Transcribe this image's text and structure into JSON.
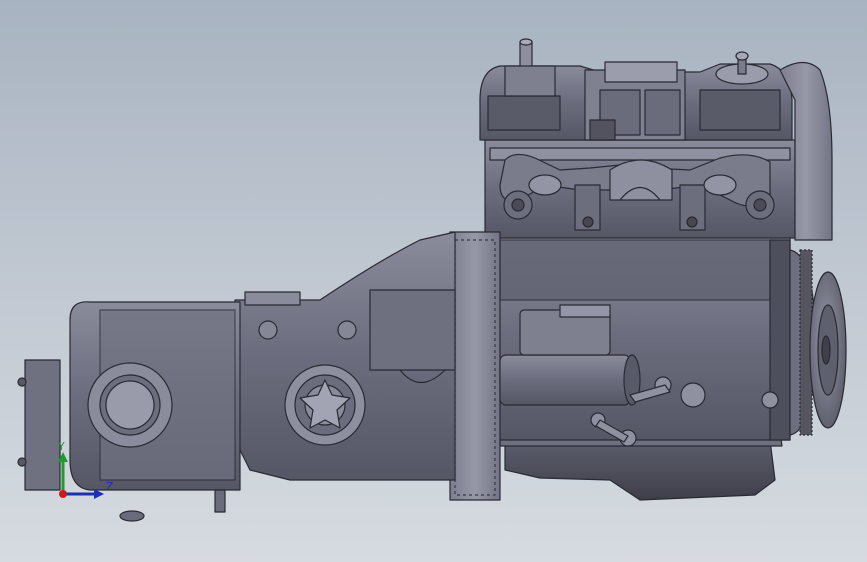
{
  "viewport": {
    "background_top": "#a8b3c1",
    "background_bottom": "#d6dbe1"
  },
  "model": {
    "body_color": "#6b6c7d",
    "light_color": "#8c8d9d",
    "dark_color": "#44454f",
    "edge_color": "#2a2a33"
  },
  "triad": {
    "y_label": "Y",
    "z_label": "Z",
    "y_color": "#1f9a2f",
    "z_color": "#1b2fb0",
    "x_color": "#d01818"
  }
}
